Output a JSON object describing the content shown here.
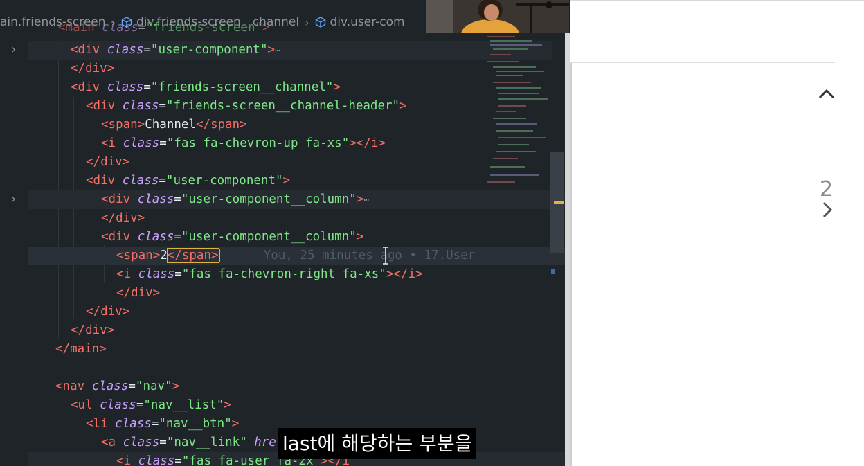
{
  "breadcrumb": [
    {
      "label": "ain.friends-screen",
      "icon": ""
    },
    {
      "label": "div.friends-screen__channel",
      "icon": "cube-icon"
    },
    {
      "label": "div.user-com",
      "icon": "cube-icon"
    }
  ],
  "code": {
    "l0": {
      "tag_open": "<main ",
      "attr": "class",
      "eq": "=",
      "str": "\"friends-screen\"",
      "tag_close": ">"
    },
    "l1": {
      "tag_open": "<div ",
      "attr": "class",
      "eq": "=",
      "str": "\"user-component\"",
      "tag_close": ">",
      "ellipsis": "⋯"
    },
    "l2": {
      "tag": "</div>"
    },
    "l3": {
      "tag_open": "<div ",
      "attr": "class",
      "eq": "=",
      "str": "\"friends-screen__channel\"",
      "tag_close": ">"
    },
    "l4": {
      "tag_open": "<div ",
      "attr": "class",
      "eq": "=",
      "str": "\"friends-screen__channel-header\"",
      "tag_close": ">"
    },
    "l5": {
      "tag_open": "<span>",
      "text": "Channel",
      "tag_close": "</span>"
    },
    "l6": {
      "tag_open": "<i ",
      "attr": "class",
      "eq": "=",
      "str": "\"fas fa-chevron-up fa-xs\"",
      "tag_close": "></i>"
    },
    "l7": {
      "tag": "</div>"
    },
    "l8": {
      "tag_open": "<div ",
      "attr": "class",
      "eq": "=",
      "str": "\"user-component\"",
      "tag_close": ">"
    },
    "l9": {
      "tag_open": "<div ",
      "attr": "class",
      "eq": "=",
      "str": "\"user-component__column\"",
      "tag_close": ">",
      "ellipsis": "⋯"
    },
    "l10": {
      "tag": "</div>"
    },
    "l11": {
      "tag_open": "<div ",
      "attr": "class",
      "eq": "=",
      "str": "\"user-component__column\"",
      "tag_close": ">"
    },
    "l12": {
      "tag_open": "<span>",
      "text": "2",
      "tag_close": "</span>",
      "blame": "You, 25 minutes ago • 17.User"
    },
    "l13": {
      "tag_open": "<i ",
      "attr": "class",
      "eq": "=",
      "str": "\"fas fa-chevron-right fa-xs\"",
      "tag_close": "></i>"
    },
    "l14": {
      "tag": "</div>"
    },
    "l15": {
      "tag": "</div>"
    },
    "l16": {
      "tag": "</div>"
    },
    "l17": {
      "tag": "</main>"
    },
    "l19": {
      "tag_open": "<nav ",
      "attr": "class",
      "eq": "=",
      "str": "\"nav\"",
      "tag_close": ">"
    },
    "l20": {
      "tag_open": "<ul ",
      "attr": "class",
      "eq": "=",
      "str": "\"nav__list\"",
      "tag_close": ">"
    },
    "l21": {
      "tag_open": "<li ",
      "attr": "class",
      "eq": "=",
      "str": "\"nav__btn\"",
      "tag_close": ">"
    },
    "l22": {
      "tag_open": "<a ",
      "attr": "class",
      "eq": "=",
      "str": "\"nav__link\"",
      "attr2": " hre"
    },
    "l23": {
      "tag_open": "<i ",
      "attr": "class",
      "eq": "=",
      "str": "\"fas fa-user fa-2x\"",
      "tag_close": "></i"
    }
  },
  "preview": {
    "count": "2"
  },
  "subtitle": "last에 해당하는 부분을",
  "colors": {
    "editor_bg": "#1f2428",
    "tag": "#f47067",
    "attr": "#c9a0ff",
    "string": "#7ee787",
    "browser_bg": "#ffffff"
  }
}
